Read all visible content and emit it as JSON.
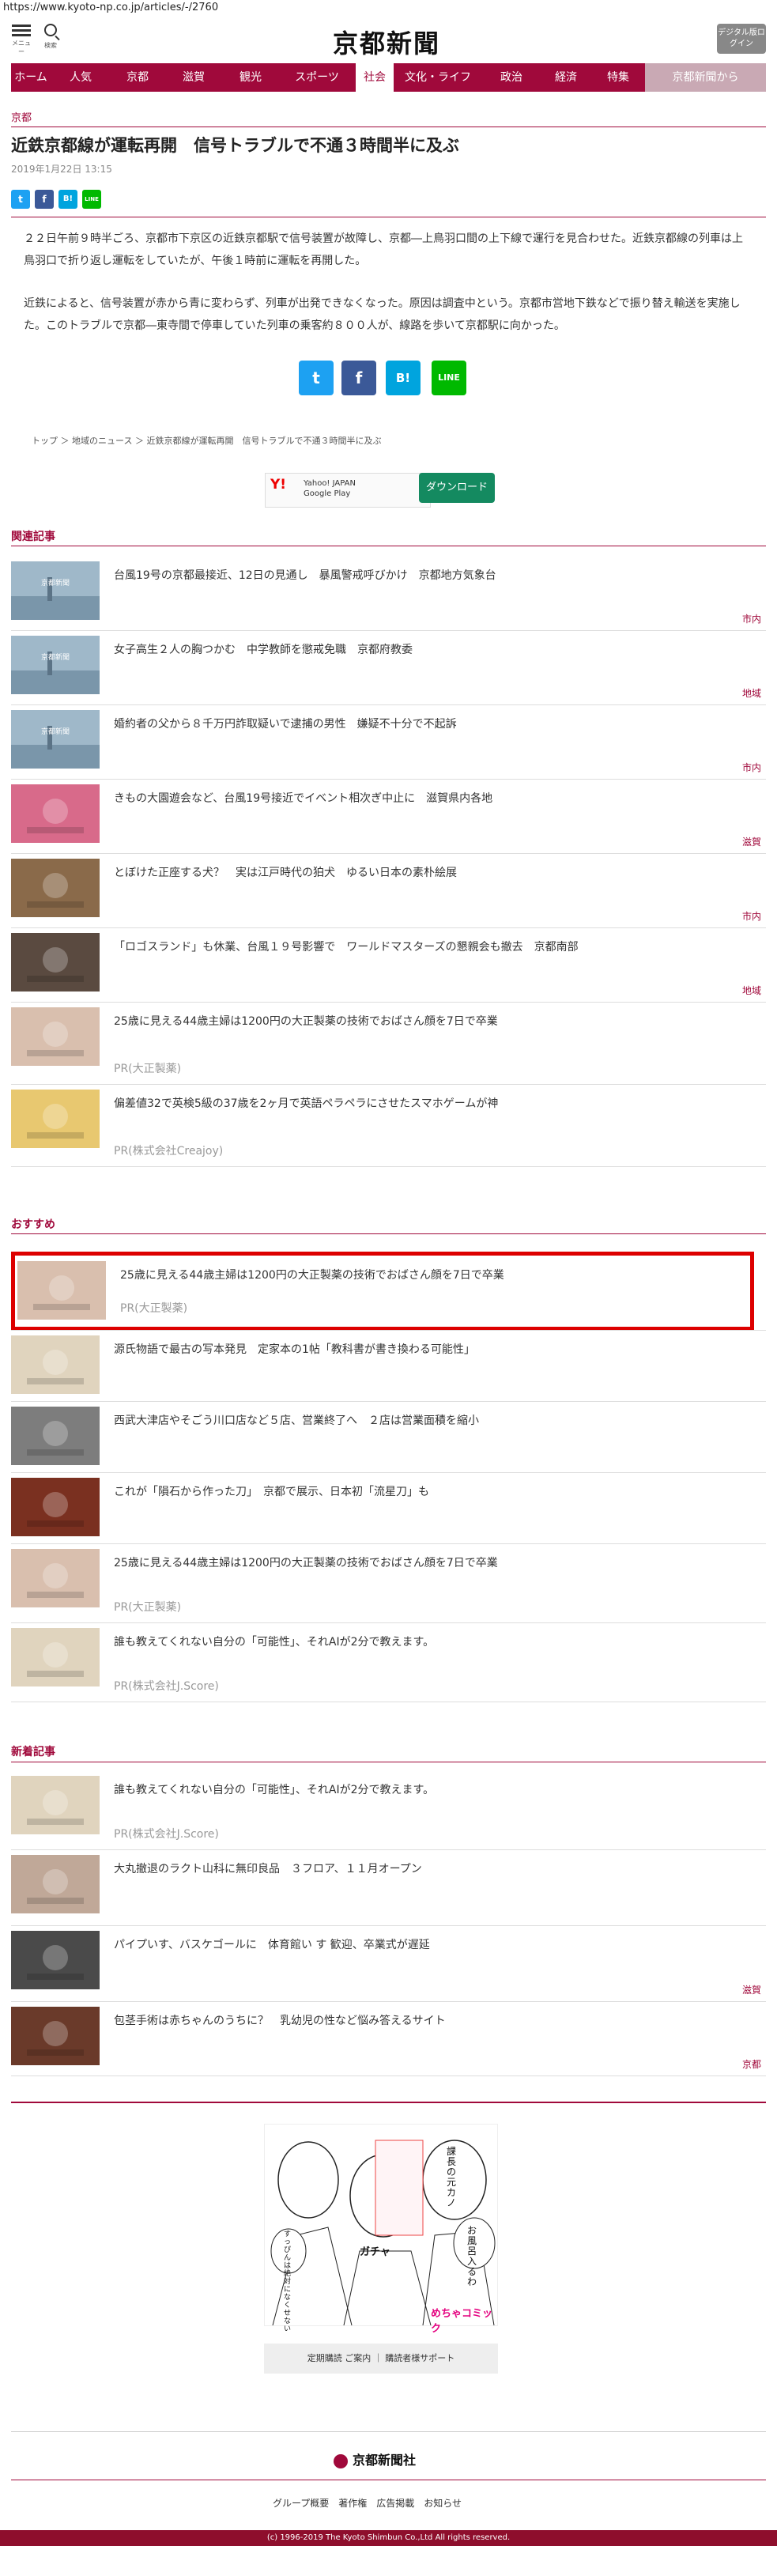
{
  "url": "https://www.kyoto-np.co.jp/articles/-/2760",
  "header": {
    "menu_label": "メニュー",
    "search_label": "検索",
    "logo": "京都新聞",
    "login_label": "デジタル版ログイン"
  },
  "nav": [
    "ホーム",
    "人気",
    "京都",
    "滋賀",
    "観光",
    "スポーツ",
    "社会",
    "文化・ライフ",
    "政治",
    "経済",
    "特集",
    "京都新聞から"
  ],
  "nav_active": "社会",
  "article": {
    "category": "京都",
    "title": "近鉄京都線が運転再開　信号トラブルで不通３時間半に及ぶ",
    "date": "2019年1月22日 13:15",
    "p1": "２２日午前９時半ごろ、京都市下京区の近鉄京都駅で信号装置が故障し、京都―上鳥羽口間の上下線で運行を見合わせた。近鉄京都線の列車は上鳥羽口で折り返し運転をしていたが、午後１時前に運転を再開した。",
    "p2": "近鉄によると、信号装置が赤から青に変わらず、列車が出発できなくなった。原因は調査中という。京都市営地下鉄などで振り替え輸送を実施した。このトラブルで京都―東寺間で停車していた列車の乗客約８００人が、線路を歩いて京都駅に向かった。"
  },
  "share": {
    "twitter": "t",
    "facebook": "f",
    "hatena": "B!",
    "line": "LINE"
  },
  "breadcrumb": [
    "トップ",
    "地域のニュース",
    "近鉄京都線が運転再開　信号トラブルで不通３時間半に及ぶ"
  ],
  "ad": {
    "brand": "Y!",
    "line1": "Yahoo! JAPAN",
    "line2": "Google Play",
    "download": "ダウンロード"
  },
  "related": {
    "heading": "関連記事",
    "items": [
      {
        "title": "台風19号の京都最接近、12日の見通し　暴風警戒呼びかけ　京都地方気象台",
        "section": "市内",
        "thumb": "京都新聞"
      },
      {
        "title": "女子高生２人の胸つかむ　中学教師を懲戒免職　京都府教委",
        "section": "地域",
        "thumb": "京都新聞"
      },
      {
        "title": "婚約者の父から８千万円詐取疑いで逮捕の男性　嫌疑不十分で不起訴",
        "section": "市内",
        "thumb": "京都新聞"
      },
      {
        "title": "きもの大園遊会など、台風19号接近でイベント相次ぎ中止に　滋賀県内各地",
        "section": "滋賀",
        "thumb": ""
      },
      {
        "title": "とぼけた正座する犬？　実は江戸時代の狛犬　ゆるい日本の素朴絵展",
        "section": "市内",
        "thumb": ""
      },
      {
        "title": "「ロゴスランド」も休業、台風１９号影響で　ワールドマスターズの懇親会も撤去　京都南部",
        "section": "地域",
        "thumb": ""
      },
      {
        "title": "25歳に見える44歳主婦は1200円の大正製薬の技術でおばさん顔を7日で卒業",
        "pr": "PR(大正製薬)",
        "thumb": ""
      },
      {
        "title": "偏差値32で英検5級の37歳を2ヶ月で英語ペラペラにさせたスマホゲームが神",
        "pr": "PR(株式会社Creajoy)",
        "thumb": ""
      }
    ]
  },
  "recommend": {
    "heading": "おすすめ",
    "items": [
      {
        "title": "25歳に見える44歳主婦は1200円の大正製薬の技術でおばさん顔を7日で卒業",
        "pr": "PR(大正製薬)"
      },
      {
        "title": "源氏物語で最古の写本発見　定家本の1帖「教科書が書き換わる可能性」"
      },
      {
        "title": "西武大津店やそごう川口店など５店、営業終了へ　２店は営業面積を縮小"
      },
      {
        "title": "これが「隕石から作った刀」　京都で展示、日本初「流星刀」も"
      },
      {
        "title": "25歳に見える44歳主婦は1200円の大正製薬の技術でおばさん顔を7日で卒業",
        "pr": "PR(大正製薬)"
      },
      {
        "title": "誰も教えてくれない自分の「可能性」、それAIが2分で教えます。",
        "pr": "PR(株式会社J.Score)"
      }
    ]
  },
  "newest": {
    "heading": "新着記事",
    "items": [
      {
        "title": "誰も教えてくれない自分の「可能性」、それAIが2分で教えます。",
        "pr": "PR(株式会社J.Score)"
      },
      {
        "title": "大丸撤退のラクト山科に無印良品　３フロア、１１月オープン",
        "section": ""
      },
      {
        "title": "パイプいす、バスケゴールに　体育館い す 歓迎、卒業式が遅延",
        "section": "滋賀"
      },
      {
        "title": "包茎手術は赤ちゃんのうちに？　乳幼児の性など悩み答えるサイト",
        "section": "京都"
      }
    ]
  },
  "manga": {
    "logo": "めちゃコミック",
    "bubble1": "課長の元カノ",
    "bubble2": "お風呂入るわ",
    "bubble3": "ガチャ",
    "side": "すっぴんは絶対になくせない"
  },
  "footer": {
    "subscribe": "定期購読 ご案内",
    "support": "購読者様サポート",
    "logo": "京都新聞社",
    "links": "グループ概要　著作権　広告掲載　お知らせ",
    "copyright": "(c) 1996-2019 The Kyoto Shimbun Co.,Ltd All rights reserved."
  },
  "colors": {
    "brand": "#a0093b",
    "highlight": "#dd0000"
  }
}
